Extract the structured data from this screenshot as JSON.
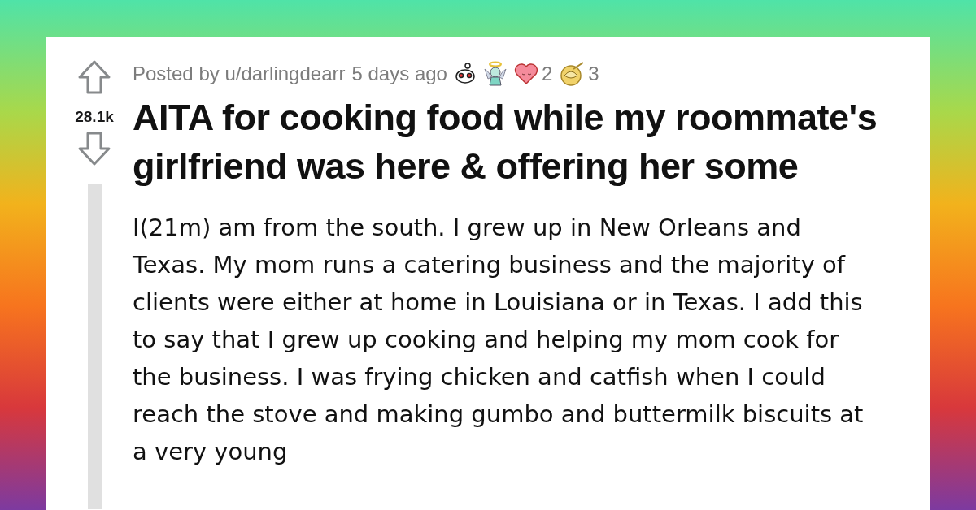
{
  "post": {
    "posted_by": "Posted by u/darlingdearr",
    "time": "5 days ago",
    "awards": [
      {
        "kind": "robot"
      },
      {
        "kind": "angel"
      },
      {
        "kind": "heart",
        "count": "2"
      },
      {
        "kind": "narwhal",
        "count": "3"
      }
    ],
    "score": "28.1k",
    "title": "AITA for cooking food while my roommate's girlfriend was here & offering her some",
    "body": "I(21m) am from the south. I grew up in New Orleans and Texas. My mom runs a catering business and the majority of clients were either at home in Louisiana or in Texas. I add this to say that I grew up cooking and helping my mom cook for the business. I was frying chicken and catfish when I could reach the stove and making gumbo and buttermilk biscuits at a very young"
  }
}
